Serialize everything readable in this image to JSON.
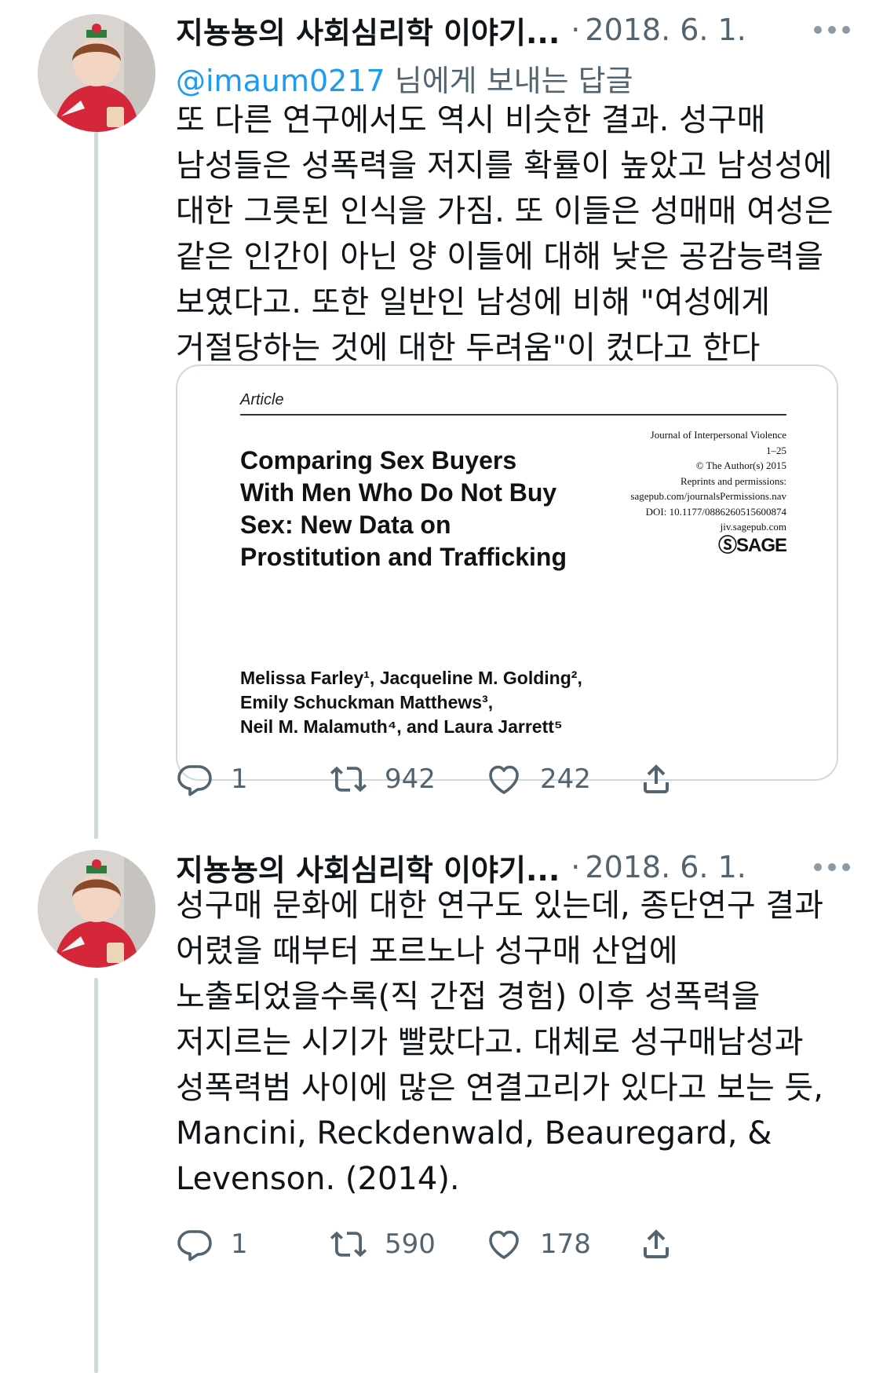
{
  "tweets": [
    {
      "author": {
        "name": "지뇽뇽의 사회심리학 이야기...",
        "avatar_icon": "profile-photo"
      },
      "separator": "·",
      "date": "2018. 6. 1.",
      "replying": {
        "handle": "@imaum0217",
        "suffix": " 님에게 보내는 답글"
      },
      "text": "또 다른 연구에서도 역시 비슷한 결과. 성구매 남성들은 성폭력을 저지를 확률이 높았고 남성성에 대한 그릇된 인식을 가짐. 또 이들은 성매매 여성은 같은 인간이 아닌 양 이들에 대해 낮은 공감능력을 보였다고. 또한 일반인 남성에 비해 \"여성에게 거절당하는 것에 대한 두려움\"이 컸다고 한다",
      "media": {
        "kind": "Article",
        "title": "Comparing Sex Buyers With Men Who Do Not Buy Sex: New Data on Prostitution and Trafficking",
        "journal_lines": [
          "Journal of Interpersonal Violence",
          "1–25",
          "© The Author(s) 2015",
          "Reprints and permissions:",
          "sagepub.com/journalsPermissions.nav",
          "DOI: 10.1177/0886260515600874",
          "jiv.sagepub.com"
        ],
        "publisher": "SAGE",
        "authors_lines": [
          "Melissa Farley¹, Jacqueline M. Golding²,",
          "Emily Schuckman Matthews³,",
          "Neil M. Malamuth⁴, and Laura Jarrett⁵"
        ]
      },
      "stats": {
        "replies": "1",
        "retweets": "942",
        "likes": "242"
      }
    },
    {
      "author": {
        "name": "지뇽뇽의 사회심리학 이야기...",
        "avatar_icon": "profile-photo"
      },
      "separator": "·",
      "date": "2018. 6. 1.",
      "text": "성구매 문화에 대한 연구도 있는데, 종단연구 결과 어렸을 때부터 포르노나 성구매 산업에 노출되었을수록(직 간접 경험) 이후 성폭력을 저지르는 시기가 빨랐다고. 대체로 성구매남성과 성폭력범 사이에 많은 연결고리가 있다고 보는 듯, Mancini, Reckdenwald, Beauregard, & Levenson. (2014).",
      "stats": {
        "replies": "1",
        "retweets": "590",
        "likes": "178"
      }
    }
  ],
  "colors": {
    "accent": "#1d9bf0",
    "secondary_text": "#536471",
    "border": "#cfd9de"
  },
  "icons": [
    "reply-icon",
    "retweet-icon",
    "like-icon",
    "share-icon",
    "more-icon"
  ]
}
